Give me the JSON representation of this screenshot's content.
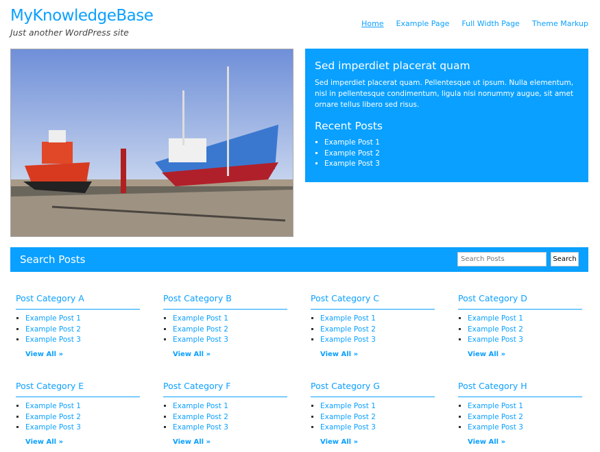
{
  "header": {
    "title": "MyKnowledgeBase",
    "tagline": "Just another WordPress site"
  },
  "nav": [
    {
      "label": "Home",
      "current": true
    },
    {
      "label": "Example Page"
    },
    {
      "label": "Full Width Page"
    },
    {
      "label": "Theme Markup"
    }
  ],
  "widget": {
    "title": "Sed imperdiet placerat quam",
    "text": "Sed imperdiet placerat quam. Pellentesque ut ipsum. Nulla elementum, nisl in pellentesque condimentum, ligula nisi nonummy augue, sit amet ornare tellus libero sed risus.",
    "recent_title": "Recent Posts",
    "recent": [
      "Example Post 1",
      "Example Post 2",
      "Example Post 3"
    ]
  },
  "search": {
    "title": "Search Posts",
    "placeholder": "Search Posts",
    "button": "Search"
  },
  "categories": [
    {
      "title": "Post Category A",
      "posts": [
        "Example Post 1",
        "Example Post 2",
        "Example Post 3"
      ],
      "view_all": "View All »"
    },
    {
      "title": "Post Category B",
      "posts": [
        "Example Post 1",
        "Example Post 2",
        "Example Post 3"
      ],
      "view_all": "View All »"
    },
    {
      "title": "Post Category C",
      "posts": [
        "Example Post 1",
        "Example Post 2",
        "Example Post 3"
      ],
      "view_all": "View All »"
    },
    {
      "title": "Post Category D",
      "posts": [
        "Example Post 1",
        "Example Post 2",
        "Example Post 3"
      ],
      "view_all": "View All »"
    },
    {
      "title": "Post Category E",
      "posts": [
        "Example Post 1",
        "Example Post 2",
        "Example Post 3"
      ],
      "view_all": "View All »"
    },
    {
      "title": "Post Category F",
      "posts": [
        "Example Post 1",
        "Example Post 2",
        "Example Post 3"
      ],
      "view_all": "View All »"
    },
    {
      "title": "Post Category G",
      "posts": [
        "Example Post 1",
        "Example Post 2",
        "Example Post 3"
      ],
      "view_all": "View All »"
    },
    {
      "title": "Post Category H",
      "posts": [
        "Example Post 1",
        "Example Post 2",
        "Example Post 3"
      ],
      "view_all": "View All »"
    }
  ],
  "colors": {
    "accent": "#0aa0ff"
  }
}
